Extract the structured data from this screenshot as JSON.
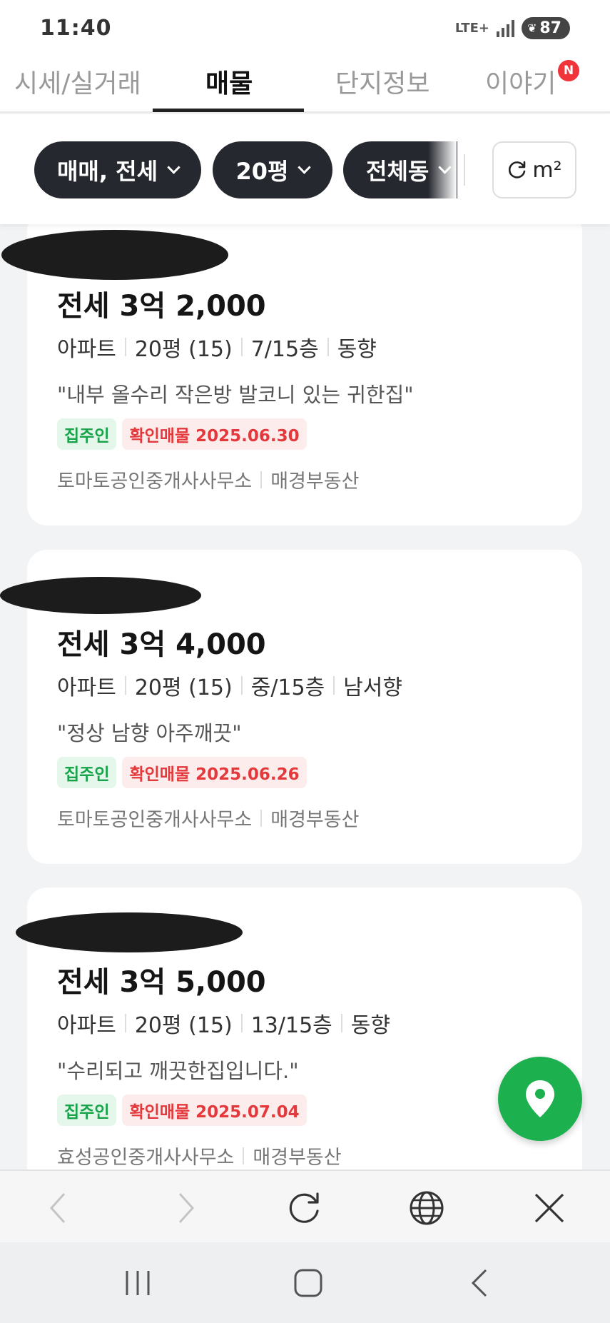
{
  "status_bar": {
    "time": "11:40",
    "network": "LTE+",
    "battery": "87"
  },
  "tabs": [
    {
      "label": "시세/실거래"
    },
    {
      "label": "매물"
    },
    {
      "label": "단지정보"
    },
    {
      "label": "이야기"
    }
  ],
  "tab_badge": "N",
  "filters": {
    "trade_type": "매매, 전세",
    "size": "20평",
    "dong": "전체동",
    "unit_label": "m²"
  },
  "listings": [
    {
      "price": "전세 3억 2,000",
      "type": "아파트",
      "size": "20평 (15)",
      "floor": "7/15층",
      "direction": "동향",
      "description": "\"내부 올수리 작은방 발코니 있는 귀한집\"",
      "owner_badge": "집주인",
      "verified_badge": "확인매물 2025.06.30",
      "agency": "토마토공인중개사사무소",
      "source": "매경부동산"
    },
    {
      "price": "전세 3억 4,000",
      "type": "아파트",
      "size": "20평 (15)",
      "floor": "중/15층",
      "direction": "남서향",
      "description": "\"정상 남향 아주깨끗\"",
      "owner_badge": "집주인",
      "verified_badge": "확인매물 2025.06.26",
      "agency": "토마토공인중개사사무소",
      "source": "매경부동산"
    },
    {
      "price": "전세 3억 5,000",
      "type": "아파트",
      "size": "20평 (15)",
      "floor": "13/15층",
      "direction": "동향",
      "description": "\"수리되고 깨끗한집입니다.\"",
      "owner_badge": "집주인",
      "verified_badge": "확인매물 2025.07.04",
      "agency": "효성공인중개사사무소",
      "source": "매경부동산"
    }
  ],
  "colors": {
    "accent_green": "#1db04e",
    "chip_dark": "#25282e",
    "owner_green": "#17a34a",
    "verified_red": "#e4393c",
    "badge_red": "#f0343a"
  },
  "icons": {
    "map_fab": "map-pin-icon",
    "browser": [
      "back-arrow-icon",
      "forward-arrow-icon",
      "refresh-icon",
      "globe-icon",
      "close-icon"
    ],
    "system_nav": [
      "recent-apps-icon",
      "home-icon",
      "back-icon"
    ]
  }
}
